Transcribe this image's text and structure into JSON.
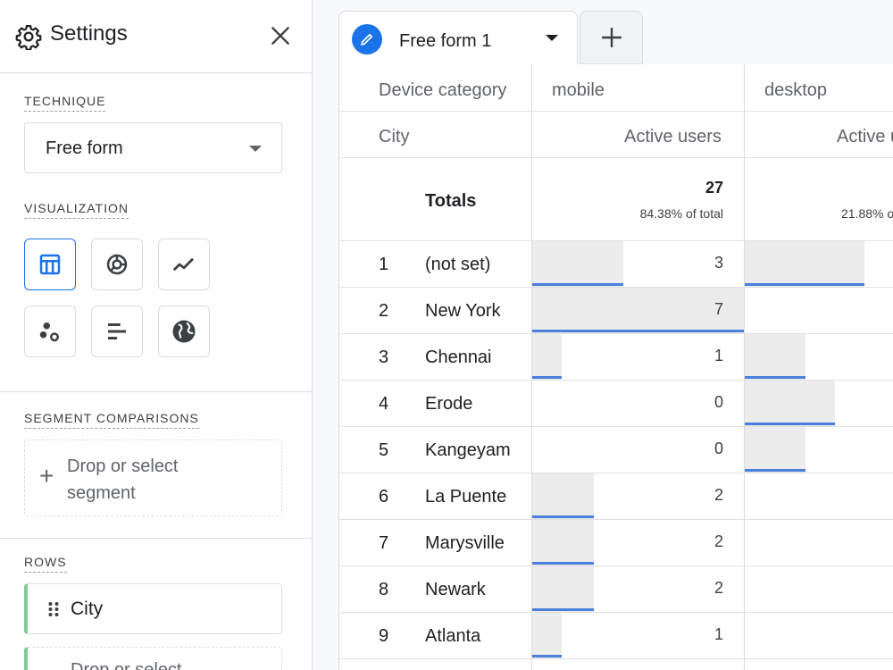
{
  "settings": {
    "title": "Settings",
    "technique_label": "TECHNIQUE",
    "technique_value": "Free form",
    "visualization_label": "VISUALIZATION",
    "visualizations": [
      "table",
      "donut-chart",
      "line-chart",
      "scatter-chart",
      "bar-chart",
      "geo-map"
    ],
    "segment_label": "SEGMENT COMPARISONS",
    "segment_drop": "Drop or select segment",
    "rows_label": "ROWS",
    "row_chip": "City",
    "row_drop": "Drop or select"
  },
  "tab": {
    "label": "Free form 1"
  },
  "table": {
    "dim_header": "Device category",
    "row_dim_header": "City",
    "columns": [
      {
        "device": "mobile",
        "metric": "Active users",
        "total": "27",
        "pct": "84.38% of total"
      },
      {
        "device": "desktop",
        "metric": "Active u",
        "total": "",
        "pct": "21.88% o"
      }
    ],
    "totals_label": "Totals",
    "rows": [
      {
        "rank": "1",
        "city": "(not set)",
        "mobile": "3",
        "mobile_frac": 0.43,
        "desktop_frac": 0.57
      },
      {
        "rank": "2",
        "city": "New York",
        "mobile": "7",
        "mobile_frac": 1.0,
        "desktop_frac": 0
      },
      {
        "rank": "3",
        "city": "Chennai",
        "mobile": "1",
        "mobile_frac": 0.14,
        "desktop_frac": 0.29
      },
      {
        "rank": "4",
        "city": "Erode",
        "mobile": "0",
        "mobile_frac": 0,
        "desktop_frac": 0.43
      },
      {
        "rank": "5",
        "city": "Kangeyam",
        "mobile": "0",
        "mobile_frac": 0,
        "desktop_frac": 0.29
      },
      {
        "rank": "6",
        "city": "La Puente",
        "mobile": "2",
        "mobile_frac": 0.29,
        "desktop_frac": 0
      },
      {
        "rank": "7",
        "city": "Marysville",
        "mobile": "2",
        "mobile_frac": 0.29,
        "desktop_frac": 0
      },
      {
        "rank": "8",
        "city": "Newark",
        "mobile": "2",
        "mobile_frac": 0.29,
        "desktop_frac": 0
      },
      {
        "rank": "9",
        "city": "Atlanta",
        "mobile": "1",
        "mobile_frac": 0.14,
        "desktop_frac": 0
      }
    ]
  },
  "colors": {
    "accent": "#1a73e8",
    "bar": "#4a7fdc",
    "bar_bg": "#ececec",
    "chip": "#81c995"
  }
}
